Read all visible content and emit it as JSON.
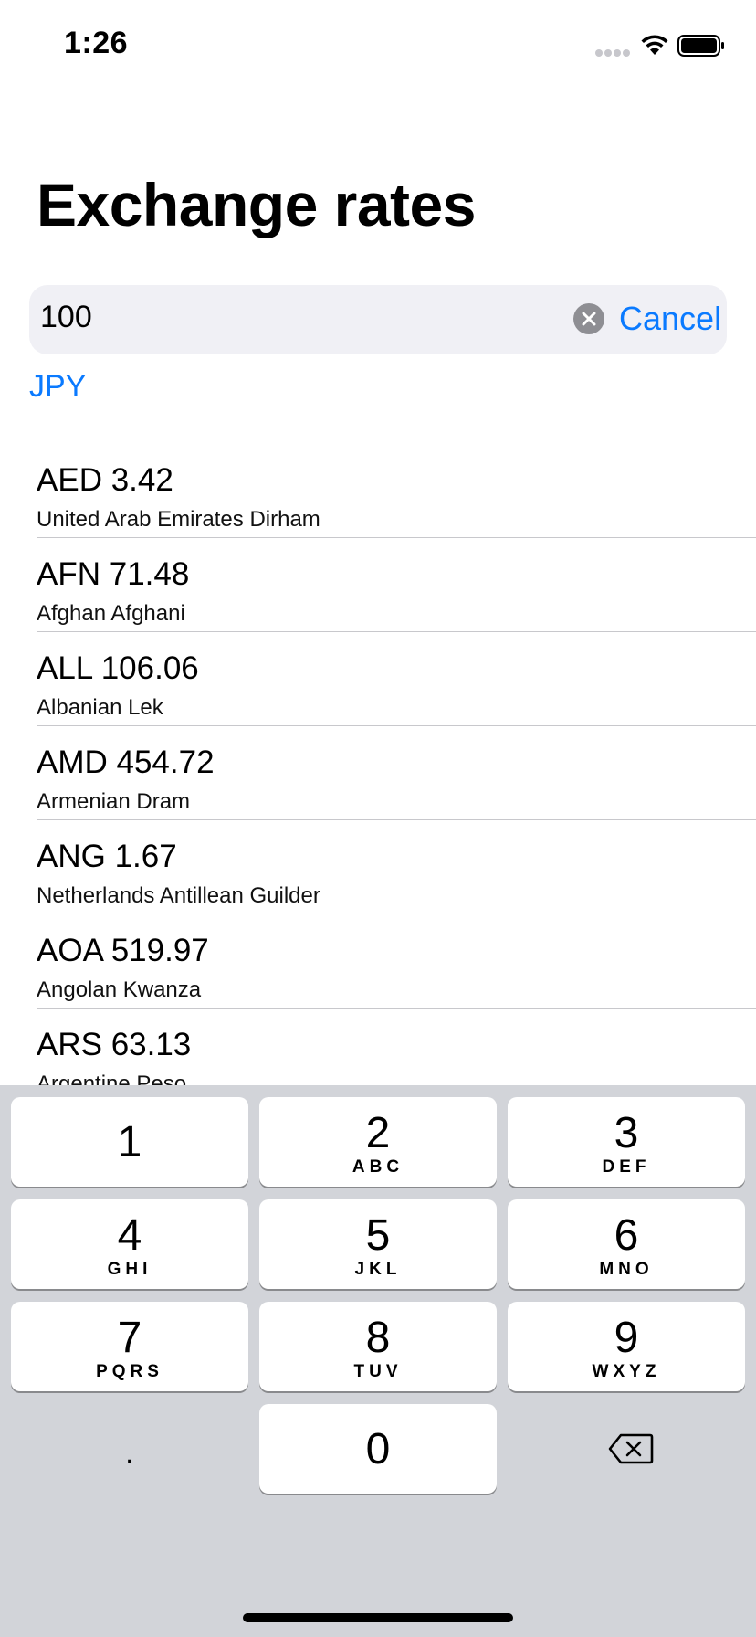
{
  "status_bar": {
    "time": "1:26",
    "icons": [
      "cellular-signal-icon",
      "wifi-icon",
      "battery-icon"
    ]
  },
  "header": {
    "title": "Exchange rates"
  },
  "search": {
    "value": "100",
    "clear_icon": "clear-icon",
    "cancel_label": "Cancel"
  },
  "base_currency": "JPY",
  "rates": [
    {
      "code_amount": "AED 3.42",
      "name": "United Arab Emirates Dirham"
    },
    {
      "code_amount": "AFN 71.48",
      "name": "Afghan Afghani"
    },
    {
      "code_amount": "ALL 106.06",
      "name": "Albanian Lek"
    },
    {
      "code_amount": "AMD 454.72",
      "name": "Armenian Dram"
    },
    {
      "code_amount": "ANG 1.67",
      "name": "Netherlands Antillean Guilder"
    },
    {
      "code_amount": "AOA 519.97",
      "name": "Angolan Kwanza"
    },
    {
      "code_amount": "ARS 63.13",
      "name": "Argentine Peso"
    }
  ],
  "keyboard": {
    "keys": [
      {
        "digit": "1",
        "letters": ""
      },
      {
        "digit": "2",
        "letters": "ABC"
      },
      {
        "digit": "3",
        "letters": "DEF"
      },
      {
        "digit": "4",
        "letters": "GHI"
      },
      {
        "digit": "5",
        "letters": "JKL"
      },
      {
        "digit": "6",
        "letters": "MNO"
      },
      {
        "digit": "7",
        "letters": "PQRS"
      },
      {
        "digit": "8",
        "letters": "TUV"
      },
      {
        "digit": "9",
        "letters": "WXYZ"
      },
      {
        "digit": "0",
        "letters": ""
      }
    ],
    "decimal_label": ".",
    "delete_icon": "backspace-icon"
  },
  "colors": {
    "accent": "#0a7aff",
    "search_background": "#f0f0f5",
    "keyboard_background": "#d2d4d9"
  }
}
